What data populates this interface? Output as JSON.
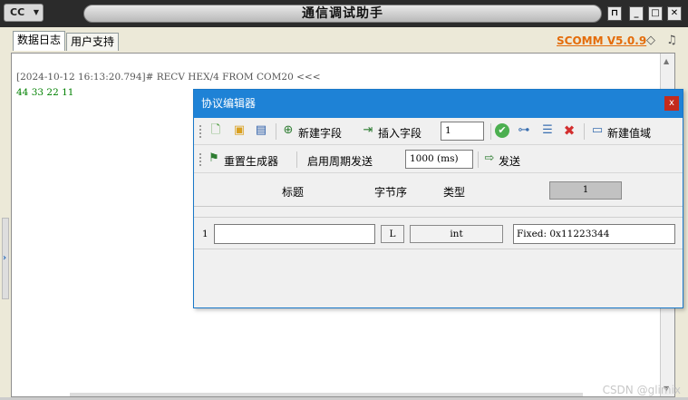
{
  "app": {
    "logo_text": "CC",
    "title": "通信调试助手",
    "version": "SCOMM V5.0.9"
  },
  "tabs": [
    {
      "label": "数据日志"
    },
    {
      "label": "用户支持"
    }
  ],
  "log": {
    "lines": [
      {
        "text": "[2024-10-12 16:13:20.794]# RECV HEX/4 FROM COM20 <<<",
        "color": "#555555"
      },
      {
        "text": "44 33 22 11",
        "color": "#008000"
      }
    ]
  },
  "dialog": {
    "title": "协议编辑器",
    "toolbar1": {
      "new_field": "新建字段",
      "insert_field": "插入字段",
      "count_value": "1",
      "new_value_domain": "新建值域"
    },
    "toolbar2": {
      "reset_generator": "重置生成器",
      "enable_periodic": "启用周期发送",
      "period_value": "1000 (ms)",
      "send": "发送"
    },
    "header": {
      "title_col": "标题",
      "byte_order_col": "字节序",
      "type_col": "类型",
      "page_button": "1"
    },
    "rows": [
      {
        "index": "1",
        "title_value": "",
        "byte_order": "L",
        "type": "int",
        "value": "Fixed: 0x11223344"
      }
    ]
  },
  "watermark": "CSDN @glimix",
  "colors": {
    "accent": "#1e82d6",
    "version": "#e46c0a",
    "recv_data": "#008000"
  }
}
